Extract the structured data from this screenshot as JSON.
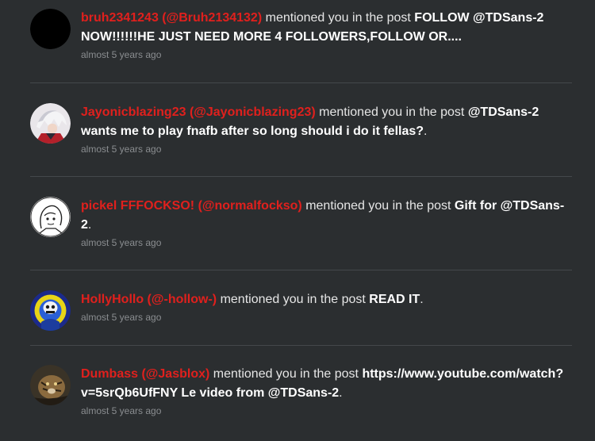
{
  "action_text": "mentioned you in the post",
  "notifications": [
    {
      "user": "bruh2341243 (@Bruh2134132)",
      "post": "FOLLOW @TDSans-2 NOW!!!!!!HE JUST NEED MORE 4 FOLLOWERS,FOLLOW OR....",
      "suffix": "",
      "time": "almost 5 years ago",
      "avatar": "black-circle"
    },
    {
      "user": "Jayonicblazing23 (@Jayonicblazing23)",
      "post": "@TDSans-2 wants me to play fnafb after so long should i do it fellas?",
      "suffix": ".",
      "time": "almost 5 years ago",
      "avatar": "anime-character-white-hair"
    },
    {
      "user": "pickel FFFOCKSO! (@normalfockso)",
      "post": "Gift for @TDSans-2",
      "suffix": ".",
      "time": "almost 5 years ago",
      "avatar": "line-drawing-sketch"
    },
    {
      "user": "HollyHollo (@-hollow-)",
      "post": "READ IT",
      "suffix": ".",
      "time": "almost 5 years ago",
      "avatar": "blue-skeleton-character"
    },
    {
      "user": "Dumbass (@Jasblox)",
      "post": "https://www.youtube.com/watch?v=5srQb6UfFNY Le video from @TDSans-2",
      "suffix": ".",
      "time": "almost 5 years ago",
      "avatar": "tiger-photo"
    }
  ]
}
